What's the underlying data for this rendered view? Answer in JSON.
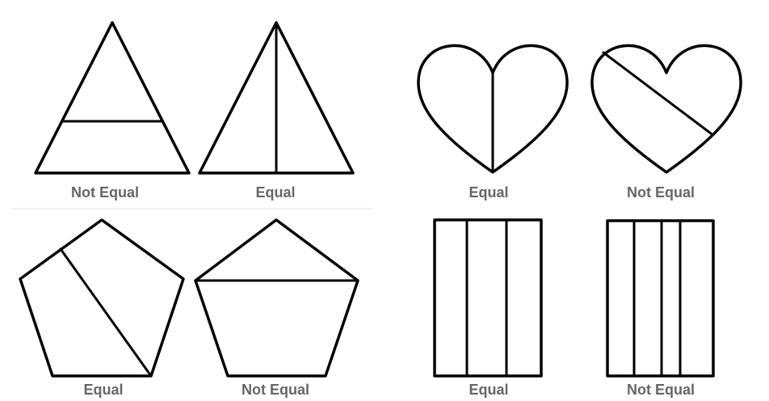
{
  "colors": {
    "stroke": "#000000",
    "caption": "#666666",
    "background": "#ffffff"
  },
  "figures": [
    {
      "shape": "triangle",
      "division": "horizontal-line",
      "label": "Not Equal"
    },
    {
      "shape": "triangle",
      "division": "vertical-line",
      "label": "Equal"
    },
    {
      "shape": "heart",
      "division": "vertical-line",
      "label": "Equal"
    },
    {
      "shape": "heart",
      "division": "diagonal-line",
      "label": "Not Equal"
    },
    {
      "shape": "pentagon",
      "division": "diagonal-line",
      "label": "Equal"
    },
    {
      "shape": "pentagon",
      "division": "horizontal-line",
      "label": "Not Equal"
    },
    {
      "shape": "rectangle",
      "division": "three-vertical-strips",
      "label": "Equal"
    },
    {
      "shape": "rectangle",
      "division": "four-vertical-strips",
      "label": "Not Equal"
    }
  ]
}
